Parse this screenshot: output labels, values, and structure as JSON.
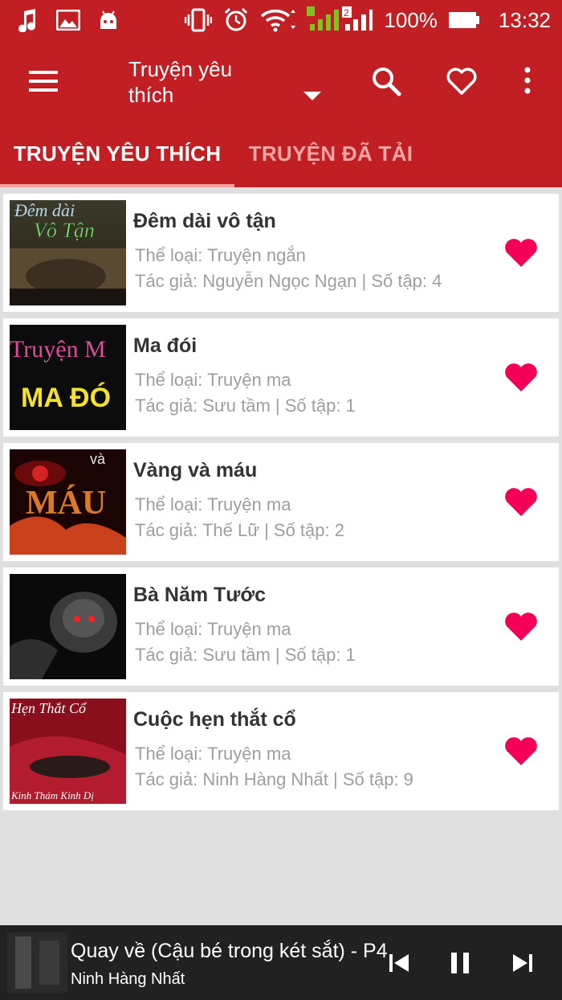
{
  "status_bar": {
    "battery": "100%",
    "time": "13:32",
    "sim_slot": "2",
    "left_icons": [
      "music-note-icon",
      "image-icon",
      "android-icon"
    ],
    "right_icons": [
      "vibrate-icon",
      "alarm-icon",
      "wifi-icon",
      "signal-icon",
      "battery-icon"
    ]
  },
  "app_bar": {
    "title": "Truyện yêu thích",
    "icons": [
      "menu-icon",
      "dropdown-arrow-icon",
      "search-icon",
      "heart-outline-icon",
      "more-vert-icon"
    ]
  },
  "tabs": [
    {
      "label": "TRUYỆN YÊU THÍCH",
      "selected": true
    },
    {
      "label": "TRUYỆN ĐÃ TẢI",
      "selected": false
    }
  ],
  "stories": [
    {
      "title": "Đêm dài vô tận",
      "genre": "Thể loại: Truyện ngắn",
      "meta": "Tác giả: Nguyễn Ngọc Ngạn | Số tập: 4",
      "cover_text": [
        "Đêm dài",
        "Vô Tận"
      ]
    },
    {
      "title": "Ma đói",
      "genre": "Thể loại: Truyện ma",
      "meta": "Tác giả: Sưu tầm | Số tập: 1",
      "cover_text": [
        "Truyện M",
        "MA ĐÓ"
      ]
    },
    {
      "title": "Vàng và máu",
      "genre": "Thể loại: Truyện ma",
      "meta": "Tác giả: Thế Lữ | Số tập: 2",
      "cover_text": [
        "và",
        "MÁU"
      ]
    },
    {
      "title": "Bà Năm Tước",
      "genre": "Thể loại: Truyện ma",
      "meta": "Tác giả: Sưu tầm | Số tập: 1",
      "cover_text": []
    },
    {
      "title": "Cuộc hẹn thắt cổ",
      "genre": "Thể loại: Truyện ma",
      "meta": "Tác giả: Ninh Hàng Nhất | Số tập: 9",
      "cover_text": [
        "Hẹn Thắt Cổ",
        "Kinh Thám Kinh Dị"
      ]
    }
  ],
  "player": {
    "title": "Quay về (Cậu bé trong két sắt) - P4",
    "artist": "Ninh Hàng Nhất",
    "controls": [
      "skip-previous-icon",
      "pause-icon",
      "skip-next-icon"
    ]
  },
  "colors": {
    "primary": "#c21f25",
    "heart": "#f50057",
    "player_bg": "#212121",
    "background": "#e0e0e0"
  }
}
